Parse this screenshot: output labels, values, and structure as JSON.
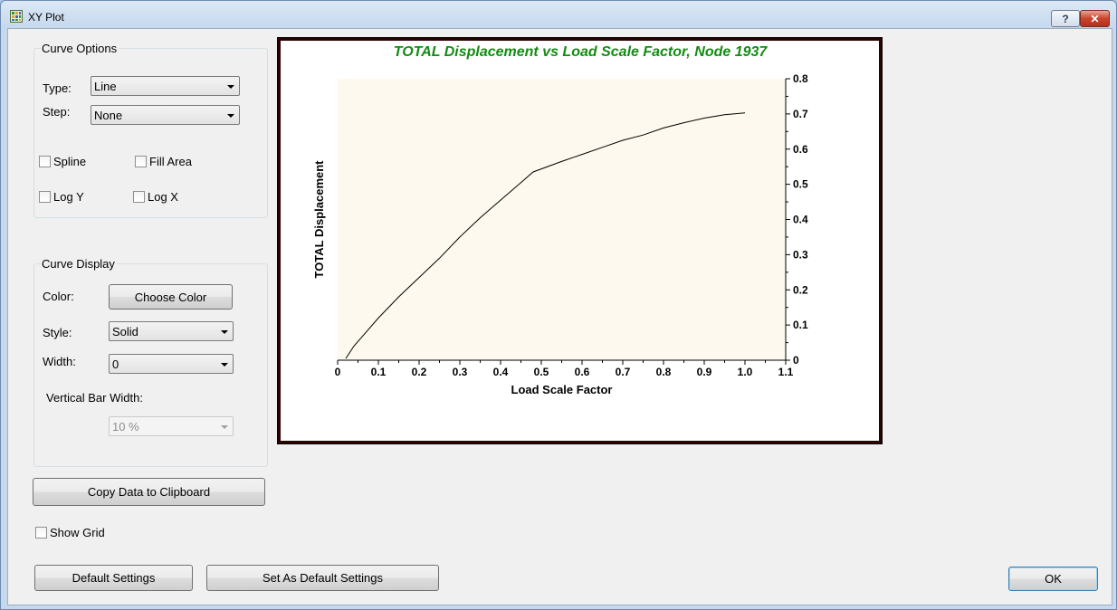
{
  "window": {
    "title": "XY Plot",
    "help_label": "?",
    "close_label": "✕"
  },
  "curve_options": {
    "group_title": "Curve Options",
    "type_label": "Type:",
    "type_value": "Line",
    "step_label": "Step:",
    "step_value": "None",
    "spline_label": "Spline",
    "fill_area_label": "Fill Area",
    "log_y_label": "Log Y",
    "log_x_label": "Log X"
  },
  "curve_display": {
    "group_title": "Curve Display",
    "color_label": "Color:",
    "choose_color_label": "Choose Color",
    "style_label": "Style:",
    "style_value": "Solid",
    "width_label": "Width:",
    "width_value": "0",
    "vbar_width_label": "Vertical Bar Width:",
    "vbar_width_value": "10 %"
  },
  "buttons": {
    "copy_data": "Copy Data to Clipboard",
    "show_grid": "Show Grid",
    "default_settings": "Default Settings",
    "set_as_default": "Set As Default Settings",
    "ok": "OK"
  },
  "colors": {
    "title_green": "#138c13",
    "plot_bg": "#fdf9ef",
    "frame_border": "#2b0000"
  },
  "chart_data": {
    "type": "line",
    "title": "TOTAL Displacement  vs Load Scale Factor, Node 1937",
    "xlabel": "Load Scale Factor",
    "ylabel": "TOTAL Displacement",
    "xlim": [
      0,
      1.1
    ],
    "ylim": [
      0,
      0.8
    ],
    "x_ticks": [
      "0",
      "0.1",
      "0.2",
      "0.3",
      "0.4",
      "0.5",
      "0.6",
      "0.7",
      "0.8",
      "0.9",
      "1.0",
      "1.1"
    ],
    "y_ticks": [
      "0",
      "0.1",
      "0.2",
      "0.3",
      "0.4",
      "0.5",
      "0.6",
      "0.7",
      "0.8"
    ],
    "y_axis_side": "right",
    "grid": false,
    "series": [
      {
        "color": "#000000",
        "x": [
          0.02,
          0.04,
          0.07,
          0.1,
          0.15,
          0.2,
          0.25,
          0.3,
          0.35,
          0.4,
          0.45,
          0.48,
          0.55,
          0.6,
          0.65,
          0.7,
          0.75,
          0.8,
          0.85,
          0.9,
          0.95,
          1.0
        ],
        "y": [
          0.005,
          0.04,
          0.08,
          0.12,
          0.18,
          0.235,
          0.29,
          0.35,
          0.405,
          0.455,
          0.505,
          0.535,
          0.565,
          0.585,
          0.605,
          0.625,
          0.64,
          0.66,
          0.675,
          0.688,
          0.698,
          0.703
        ]
      }
    ]
  }
}
